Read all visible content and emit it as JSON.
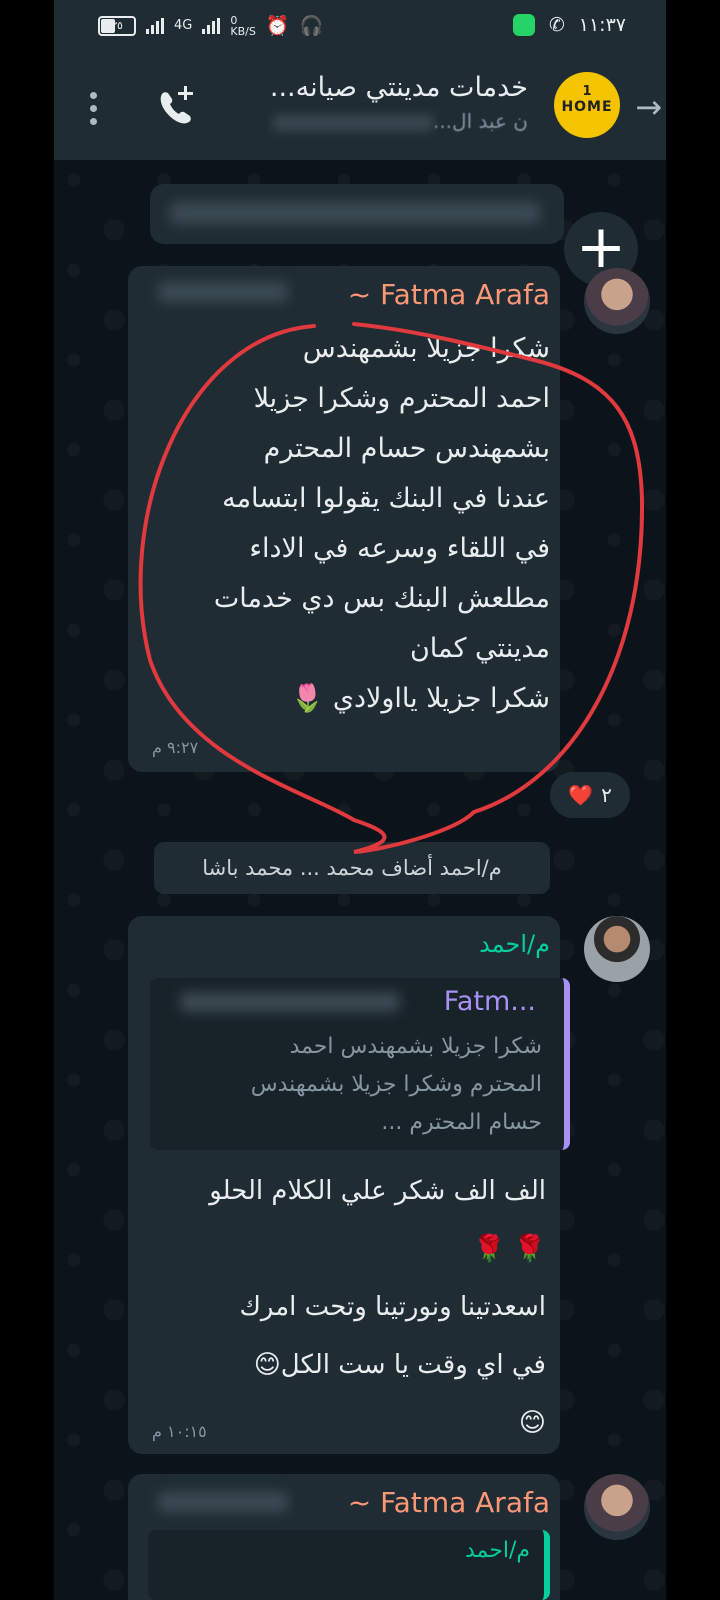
{
  "status_bar": {
    "battery": "٣٥",
    "network": "4G",
    "speed": "0\nKB/S",
    "time": "١١:٣٧"
  },
  "header": {
    "title": "خدمات مدينتي صيانه...",
    "subtitle": "ن عبد ال...",
    "avatar_text_1": "1",
    "avatar_text_2": "HOME",
    "icons": [
      "menu-dots-icon",
      "add-call-icon",
      "back-arrow-icon"
    ]
  },
  "messages": [
    {
      "sender": "~ Fatma Arafa",
      "text": "شكرا جزيلا بشمهندس\nاحمد المحترم وشكرا جزيلا\nبشمهندس حسام المحترم\nعندنا في البنك يقولوا ابتسامه\nفي اللقاء وسرعه في الاداء\nمطلعش البنك بس دي خدمات\nمدينتي كمان\nشكرا جزيلا يااولادي 🌷",
      "time": "٩:٢٧ م",
      "reaction": "❤️",
      "reaction_count": "٢"
    },
    {
      "type": "system",
      "text": "م/احمد أضاف محمد ... محمد باشا"
    },
    {
      "sender": "م/احمد",
      "quote_name": "Fatm...",
      "quote_text": "شكرا جزيلا بشمهندس احمد\nالمحترم وشكرا جزيلا بشمهندس\nحسام المحترم ...",
      "text": "الف الف شكر علي الكلام الحلو\n🌹 🌹\nاسعدتينا ونورتينا وتحت امرك\nفي اي وقت يا ست الكل😊\n😊",
      "time": "١٠:١٥ م"
    },
    {
      "sender": "~ Fatma Arafa",
      "quote_name": "م/احمد"
    }
  ]
}
